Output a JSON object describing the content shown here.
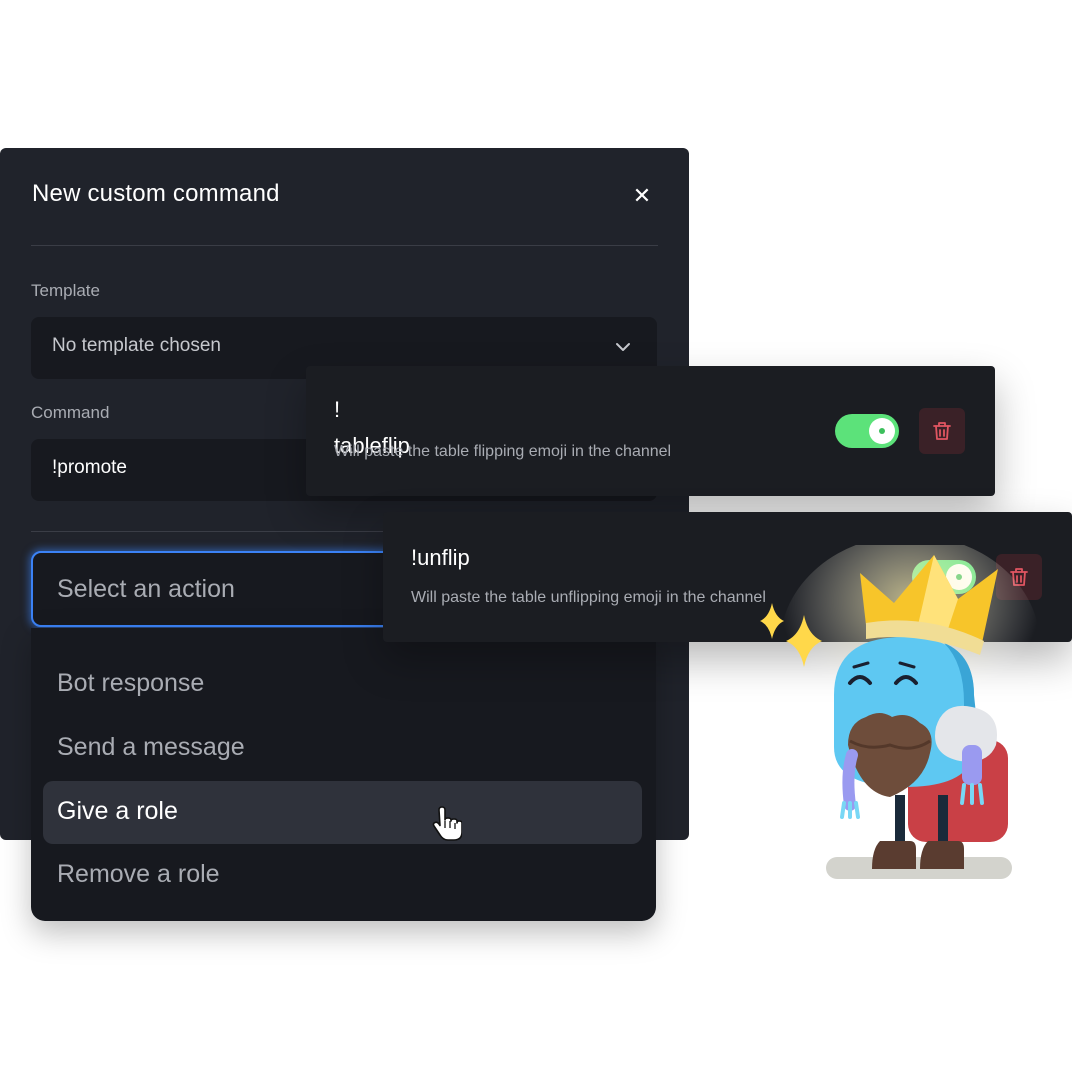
{
  "modal": {
    "title": "New custom command",
    "close_icon": "close-icon",
    "template_label": "Template",
    "template_value": "No template chosen",
    "command_label": "Command",
    "command_value": "!promote",
    "action_placeholder": "Select an action",
    "action_options": [
      {
        "label": "Bot response",
        "selected": false
      },
      {
        "label": "Send a message",
        "selected": false
      },
      {
        "label": "Give a role",
        "selected": true
      },
      {
        "label": "Remove a role",
        "selected": false
      }
    ]
  },
  "commands": [
    {
      "name": "!\ntableflip",
      "description": "Will paste the table flipping emoji in the channel",
      "enabled": true
    },
    {
      "name": "!unflip",
      "description": "Will paste the table unflipping emoji in the channel",
      "enabled": true
    }
  ],
  "colors": {
    "panel": "#20232b",
    "field": "#17191f",
    "focus": "#3b82f6",
    "toggle_on": "#5ce27a",
    "delete": "#e05561"
  }
}
